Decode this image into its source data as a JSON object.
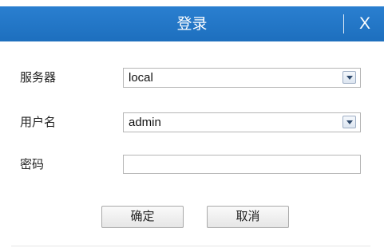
{
  "dialog": {
    "title": "登录",
    "close_label": "X"
  },
  "form": {
    "server": {
      "label": "服务器",
      "value": "local"
    },
    "username": {
      "label": "用户名",
      "value": "admin"
    },
    "password": {
      "label": "密码",
      "value": ""
    }
  },
  "buttons": {
    "confirm_label": "确定",
    "cancel_label": "取消"
  },
  "colors": {
    "titlebar": "#1d6fbe",
    "title_text": "#ffffff"
  },
  "icons": {
    "dropdown": "chevron-down-icon"
  }
}
